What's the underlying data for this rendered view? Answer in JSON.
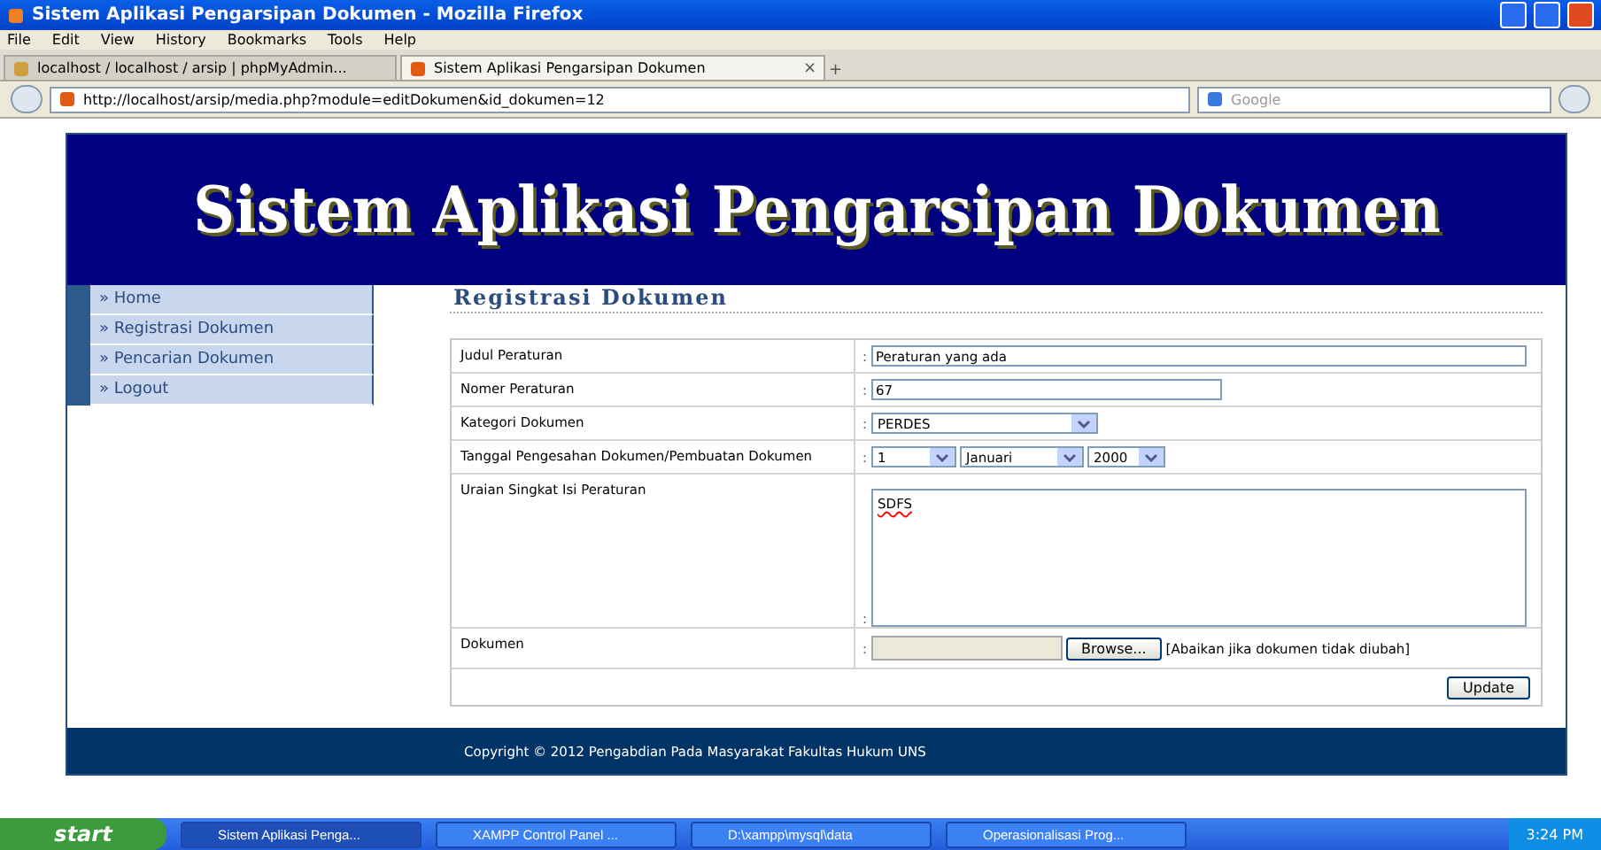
{
  "window": {
    "title": "Sistem Aplikasi Pengarsipan Dokumen - Mozilla Firefox"
  },
  "menu": [
    "File",
    "Edit",
    "View",
    "History",
    "Bookmarks",
    "Tools",
    "Help"
  ],
  "tabs": [
    {
      "label": "localhost / localhost / arsip | phpMyAdmin...",
      "selected": false
    },
    {
      "label": "Sistem Aplikasi Pengarsipan Dokumen",
      "selected": true
    }
  ],
  "tab_close": "×",
  "tab_new": "+",
  "address": {
    "url": "http://localhost/arsip/media.php?module=editDokumen&id_dokumen=12"
  },
  "search": {
    "placeholder": "Google"
  },
  "site": {
    "title": "Sistem Aplikasi Pengarsipan Dokumen"
  },
  "nav": [
    {
      "label": "» Home",
      "selected": false
    },
    {
      "label": "» Registrasi Dokumen",
      "selected": false
    },
    {
      "label": "» Pencarian Dokumen",
      "selected": false
    },
    {
      "label": "» Logout",
      "selected": false
    }
  ],
  "section_title": "Registrasi Dokumen",
  "form": [
    {
      "kind": "text",
      "label": "Judul Peraturan",
      "value": "Peraturan yang ada"
    },
    {
      "kind": "short",
      "label": "Nomer Peraturan",
      "value": "67"
    },
    {
      "kind": "select",
      "label": "Kategori Dokumen",
      "value": "PERDES"
    },
    {
      "kind": "date",
      "label": "Tanggal Pengesahan Dokumen/Pembuatan Dokumen",
      "day": "1",
      "month": "Januari",
      "year": "2000"
    },
    {
      "kind": "textarea",
      "label": "Uraian Singkat Isi Peraturan",
      "value": "SDFS"
    },
    {
      "kind": "file",
      "label": "Dokumen",
      "button": "Browse...",
      "note": "[Abaikan jika dokumen tidak diubah]"
    }
  ],
  "separator": ":",
  "submit": "Update",
  "footer": "Copyright © 2012 Pengabdian Pada Masyarakat Fakultas Hukum UNS",
  "taskbar": {
    "start": "start",
    "tasks": [
      {
        "label": "Sistem Aplikasi Penga...",
        "selected": true
      },
      {
        "label": "XAMPP Control Panel ...",
        "selected": false
      },
      {
        "label": "D:\\xampp\\mysql\\data",
        "selected": false
      },
      {
        "label": "Operasionalisasi Prog...",
        "selected": false
      }
    ],
    "clock": "3:24 PM"
  }
}
